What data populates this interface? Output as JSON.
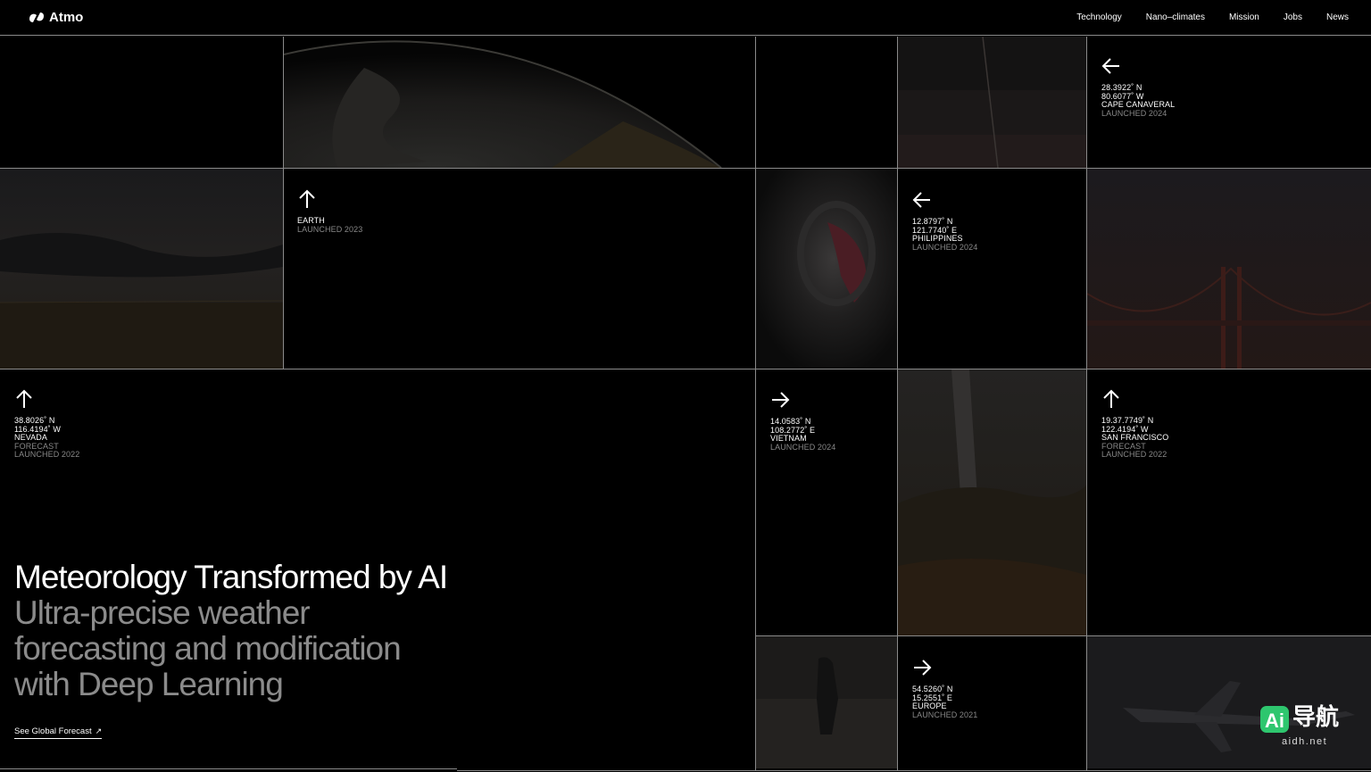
{
  "brand": {
    "name": "Atmo"
  },
  "nav": {
    "items": [
      "Technology",
      "Nano–climates",
      "Mission",
      "Jobs",
      "News"
    ]
  },
  "tiles": {
    "cape": {
      "lat": "28.3922˚ N",
      "lon": "80.6077˚ W",
      "place": "CAPE CANAVERAL",
      "status": "LAUNCHED 2024",
      "arrow": "arrow-left-icon"
    },
    "earth": {
      "place": "EARTH",
      "status": "LAUNCHED 2023",
      "arrow": "arrow-up-icon"
    },
    "philippines": {
      "lat": "12.8797˚ N",
      "lon": "121.7740˚ E",
      "place": "PHILIPPINES",
      "status": "LAUNCHED 2024",
      "arrow": "arrow-left-icon"
    },
    "nevada": {
      "lat": "38.8026˚ N",
      "lon": "116.4194˚ W",
      "place": "NEVADA",
      "kind": "FORECAST",
      "status": "LAUNCHED 2022",
      "arrow": "arrow-up-icon"
    },
    "vietnam": {
      "lat": "14.0583˚ N",
      "lon": "108.2772˚ E",
      "place": "VIETNAM",
      "status": "LAUNCHED 2024",
      "arrow": "arrow-right-icon"
    },
    "sanfrancisco": {
      "lat": "19.37.7749˚ N",
      "lon": "122.4194˚ W",
      "place": "SAN FRANCISCO",
      "kind": "FORECAST",
      "status": "LAUNCHED 2022",
      "arrow": "arrow-up-icon"
    },
    "europe": {
      "lat": "54.5260˚ N",
      "lon": "15.2551˚ E",
      "place": "EUROPE",
      "status": "LAUNCHED 2021",
      "arrow": "arrow-right-icon"
    }
  },
  "hero": {
    "title": "Meteorology Transformed by AI",
    "subtitle_lines": [
      "Ultra-precise weather",
      "forecasting and modification",
      "with Deep Learning"
    ]
  },
  "cta": {
    "label": "See Global Forecast",
    "icon": "external-arrow-icon"
  },
  "watermark": {
    "text": "导航",
    "domain": "aidh.net"
  },
  "colors": {
    "background": "#000000",
    "grid": "#8a8a8a",
    "muted": "#888888",
    "watermark_green": "#2ec66e"
  }
}
